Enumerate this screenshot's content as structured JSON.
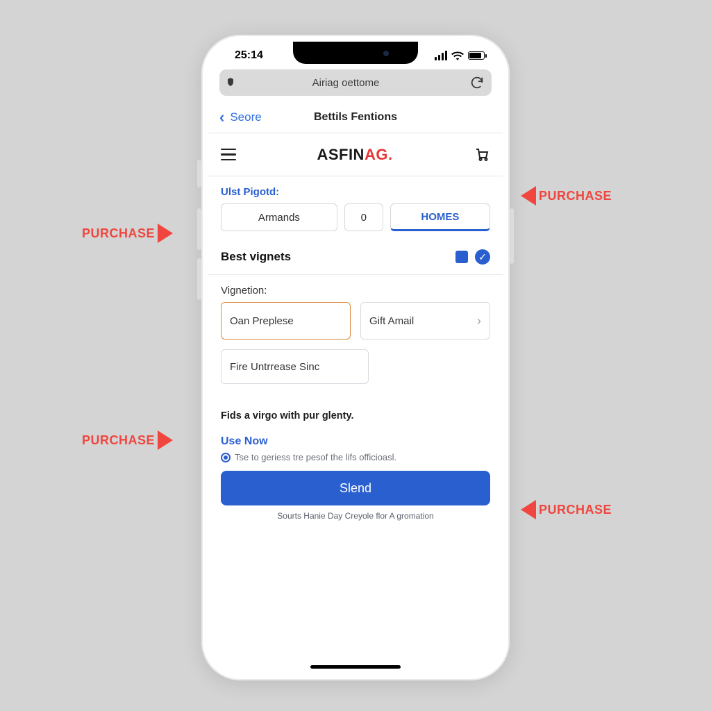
{
  "callout_label": "PURCHASE",
  "status": {
    "time": "25:14"
  },
  "urlbar": {
    "address": "Airiag oettome"
  },
  "nav": {
    "back": "Seore",
    "title": "Bettils Fentions"
  },
  "brand": {
    "part1": "ASFIN",
    "part2": "AG",
    "dot": "."
  },
  "section": {
    "label": "Ulst Pigotd:",
    "pills": [
      "Armands",
      "0",
      "HOMES"
    ]
  },
  "best": {
    "title": "Best vignets"
  },
  "vignetion": {
    "label": "Vignetion:",
    "opt1": "Oan Preplese",
    "opt2": "Gift Amail",
    "opt3": "Fire Untrrease Sinc"
  },
  "hint": "Fids a virgo with pur glenty.",
  "usenow": {
    "title": "Use Now",
    "sub": "Tse to geriess tre pesof the lifs officioasl."
  },
  "cta": "Slend",
  "footer": "Sourts Hanie Day Creyole flor A gromation"
}
